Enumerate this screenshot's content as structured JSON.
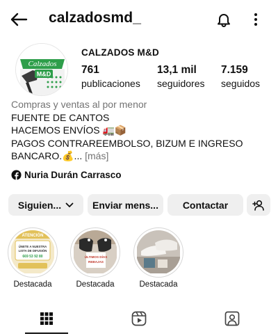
{
  "header": {
    "username": "calzadosmd_",
    "icons": {
      "back": "back-arrow-icon",
      "bell": "notification-bell-icon",
      "more": "more-vertical-icon"
    }
  },
  "profile": {
    "display_name": "CALZADOS M&D",
    "avatar_text": [
      "Calzados",
      "M&D"
    ],
    "stats": [
      {
        "value": "761",
        "label": "publicaciones"
      },
      {
        "value": "13,1 mil",
        "label": "seguidores"
      },
      {
        "value": "7.159",
        "label": "seguidos"
      }
    ]
  },
  "bio": {
    "category": "Compras y ventas al por menor",
    "lines": [
      "FUENTE DE CANTOS",
      "HACEMOS ENVÍOS 🚛📦",
      "PAGOS CONTRAREEMBOLSO, BIZUM E INGRESO",
      "BANCARO.💰..."
    ],
    "more_label": "[más]"
  },
  "linked_account": {
    "icon": "facebook-icon",
    "name": "Nuria Durán Carrasco"
  },
  "actions": {
    "following_label": "Siguien...",
    "message_label": "Enviar mens...",
    "contact_label": "Contactar",
    "add_user_icon": "add-user-icon"
  },
  "highlights": [
    {
      "label": "Destacada",
      "thumb_text": [
        "ATENCIÓN",
        "ÚNETE A NUESTRA",
        "LISTA DE DIFUSIÓN",
        "669 53 92 80"
      ]
    },
    {
      "label": "Destacada",
      "thumb_text": [
        "ÚLTIMOS DÍAS",
        "REBAJAS"
      ]
    },
    {
      "label": "Destacada",
      "thumb_text": []
    }
  ],
  "tabs": [
    {
      "name": "posts",
      "icon": "grid-icon",
      "active": true
    },
    {
      "name": "reels",
      "icon": "reels-icon",
      "active": false
    },
    {
      "name": "tagged",
      "icon": "tagged-user-icon",
      "active": false
    }
  ],
  "colors": {
    "text": "#0f0f0f",
    "muted": "#737373",
    "button_bg": "#efefef",
    "brand_green": "#2e9e4a"
  }
}
